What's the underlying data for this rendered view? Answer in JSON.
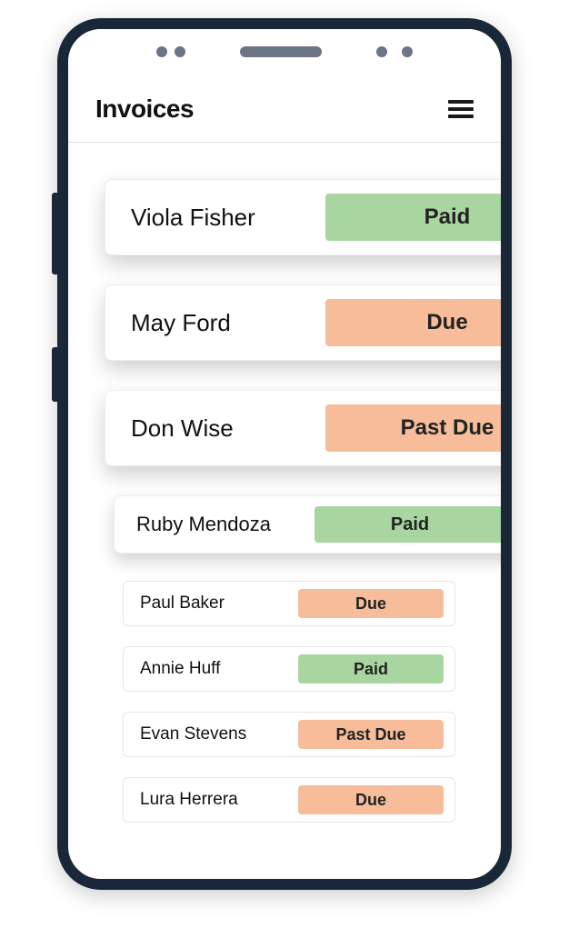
{
  "header": {
    "title": "Invoices"
  },
  "status_labels": {
    "paid": "Paid",
    "due": "Due",
    "past_due": "Past Due"
  },
  "colors": {
    "paid": "#a9d6a0",
    "due": "#f7bd9a",
    "past_due": "#f7bd9a"
  },
  "invoices": [
    {
      "name": "Viola Fisher",
      "status": "paid",
      "size": "large"
    },
    {
      "name": "May Ford",
      "status": "due",
      "size": "large"
    },
    {
      "name": "Don Wise",
      "status": "past_due",
      "size": "large"
    },
    {
      "name": "Ruby Mendoza",
      "status": "paid",
      "size": "medium"
    },
    {
      "name": "Paul Baker",
      "status": "due",
      "size": "small"
    },
    {
      "name": "Annie Huff",
      "status": "paid",
      "size": "small"
    },
    {
      "name": "Evan Stevens",
      "status": "past_due",
      "size": "small"
    },
    {
      "name": "Lura Herrera",
      "status": "due",
      "size": "small"
    }
  ]
}
